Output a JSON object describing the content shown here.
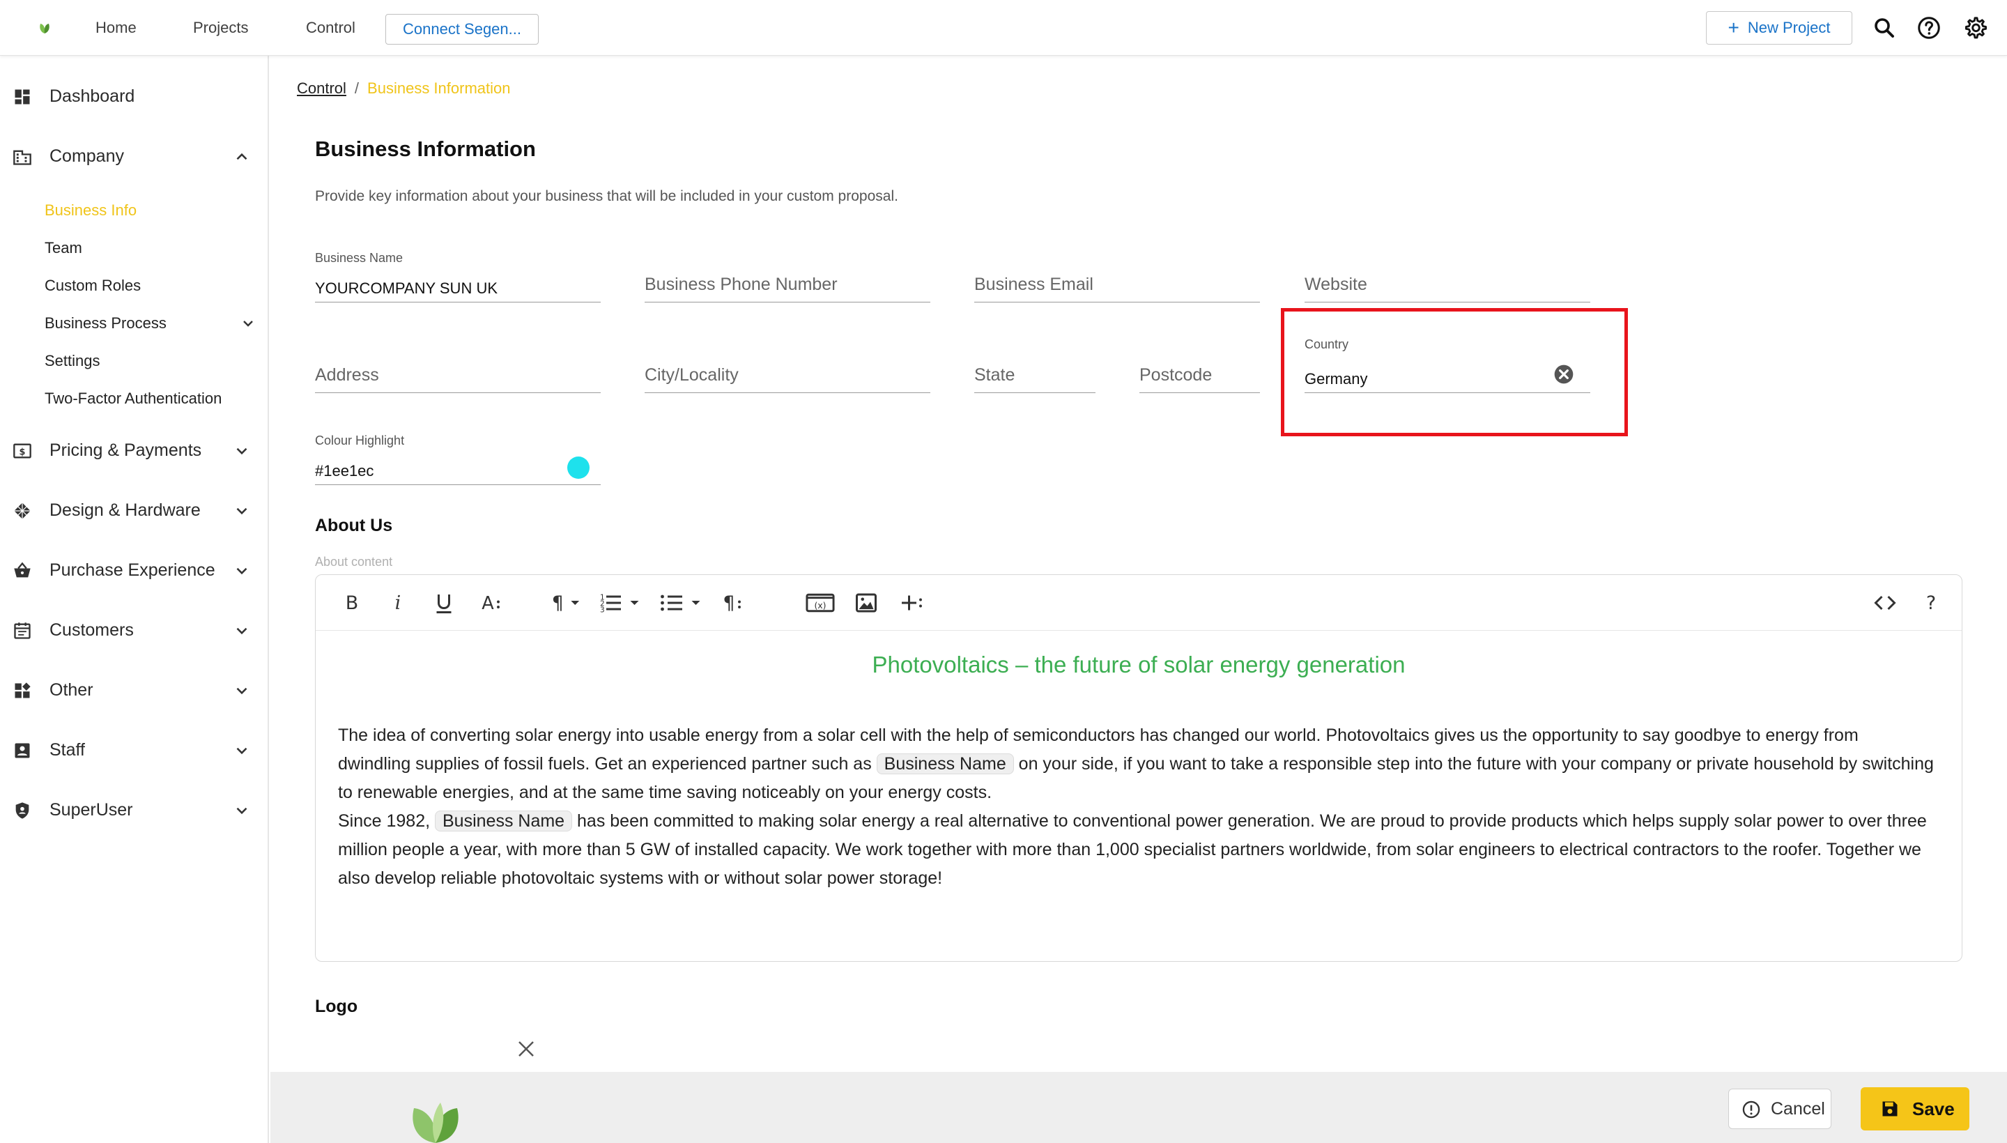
{
  "topbar": {
    "nav": [
      "Home",
      "Projects",
      "Control"
    ],
    "connect_label": "Connect Segen...",
    "new_project_label": "New Project"
  },
  "sidebar": {
    "dashboard": "Dashboard",
    "company": "Company",
    "company_sub": [
      "Business Info",
      "Team",
      "Custom Roles",
      "Business Process",
      "Settings",
      "Two-Factor Authentication"
    ],
    "pricing": "Pricing & Payments",
    "design": "Design & Hardware",
    "purchase": "Purchase Experience",
    "customers": "Customers",
    "other": "Other",
    "staff": "Staff",
    "superuser": "SuperUser"
  },
  "breadcrumb": {
    "parent": "Control",
    "separator": "/",
    "current": "Business Information"
  },
  "page": {
    "title": "Business Information",
    "description": "Provide key information about your business that will be included in your custom proposal."
  },
  "form": {
    "business_name_label": "Business Name",
    "business_name_value": "YOURCOMPANY SUN UK",
    "phone_placeholder": "Business Phone Number",
    "email_placeholder": "Business Email",
    "website_placeholder": "Website",
    "address_placeholder": "Address",
    "city_placeholder": "City/Locality",
    "state_placeholder": "State",
    "postcode_placeholder": "Postcode",
    "country_label": "Country",
    "country_value": "Germany",
    "colour_label": "Colour Highlight",
    "colour_value": "#1ee1ec"
  },
  "about": {
    "title": "About Us",
    "hint": "About content",
    "heading": "Photovoltaics – the future of solar energy generation",
    "chip": "Business Name",
    "p1a": "The idea of converting solar energy into usable energy from a solar cell with the help of semiconductors has changed our world. Photovoltaics gives us the opportunity to say goodbye to energy from dwindling supplies of fossil fuels. Get an experienced partner such as ",
    "p1b": " on your side, if you want to take a responsible step into the future with your company or private household by switching to renewable energies, and at the same time saving noticeably on your energy costs.",
    "p2a": "Since 1982, ",
    "p2b": " has been committed to making solar energy a real alternative to conventional power generation. We are proud to provide products which helps supply solar power to over three million people a year, with more than 5 GW of installed capacity. We work together with more than 1,000 specialist partners worldwide, from solar engineers to electrical contractors to the roofer. Together we also develop reliable photovoltaic systems with or without solar power storage!"
  },
  "logo_section": {
    "title": "Logo"
  },
  "actions": {
    "cancel": "Cancel",
    "save": "Save"
  },
  "colors": {
    "accent": "#f0c419",
    "link": "#1a73c8",
    "highlight_box": "#e8141c",
    "heading_green": "#3cae52",
    "colour_swatch": "#1ee1ec"
  }
}
